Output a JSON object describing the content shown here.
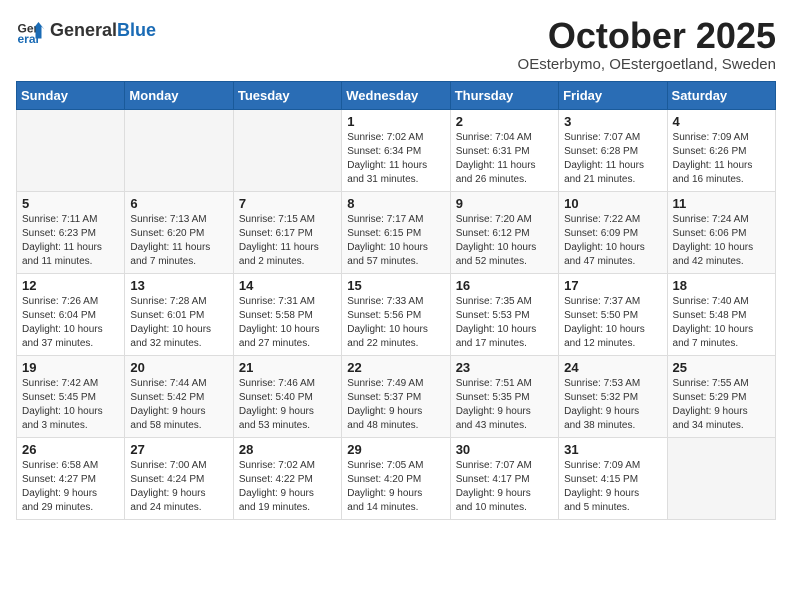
{
  "header": {
    "logo_general": "General",
    "logo_blue": "Blue",
    "month": "October 2025",
    "location": "OEsterbymo, OEstergoetland, Sweden"
  },
  "weekdays": [
    "Sunday",
    "Monday",
    "Tuesday",
    "Wednesday",
    "Thursday",
    "Friday",
    "Saturday"
  ],
  "weeks": [
    [
      {
        "day": "",
        "info": ""
      },
      {
        "day": "",
        "info": ""
      },
      {
        "day": "",
        "info": ""
      },
      {
        "day": "1",
        "info": "Sunrise: 7:02 AM\nSunset: 6:34 PM\nDaylight: 11 hours\nand 31 minutes."
      },
      {
        "day": "2",
        "info": "Sunrise: 7:04 AM\nSunset: 6:31 PM\nDaylight: 11 hours\nand 26 minutes."
      },
      {
        "day": "3",
        "info": "Sunrise: 7:07 AM\nSunset: 6:28 PM\nDaylight: 11 hours\nand 21 minutes."
      },
      {
        "day": "4",
        "info": "Sunrise: 7:09 AM\nSunset: 6:26 PM\nDaylight: 11 hours\nand 16 minutes."
      }
    ],
    [
      {
        "day": "5",
        "info": "Sunrise: 7:11 AM\nSunset: 6:23 PM\nDaylight: 11 hours\nand 11 minutes."
      },
      {
        "day": "6",
        "info": "Sunrise: 7:13 AM\nSunset: 6:20 PM\nDaylight: 11 hours\nand 7 minutes."
      },
      {
        "day": "7",
        "info": "Sunrise: 7:15 AM\nSunset: 6:17 PM\nDaylight: 11 hours\nand 2 minutes."
      },
      {
        "day": "8",
        "info": "Sunrise: 7:17 AM\nSunset: 6:15 PM\nDaylight: 10 hours\nand 57 minutes."
      },
      {
        "day": "9",
        "info": "Sunrise: 7:20 AM\nSunset: 6:12 PM\nDaylight: 10 hours\nand 52 minutes."
      },
      {
        "day": "10",
        "info": "Sunrise: 7:22 AM\nSunset: 6:09 PM\nDaylight: 10 hours\nand 47 minutes."
      },
      {
        "day": "11",
        "info": "Sunrise: 7:24 AM\nSunset: 6:06 PM\nDaylight: 10 hours\nand 42 minutes."
      }
    ],
    [
      {
        "day": "12",
        "info": "Sunrise: 7:26 AM\nSunset: 6:04 PM\nDaylight: 10 hours\nand 37 minutes."
      },
      {
        "day": "13",
        "info": "Sunrise: 7:28 AM\nSunset: 6:01 PM\nDaylight: 10 hours\nand 32 minutes."
      },
      {
        "day": "14",
        "info": "Sunrise: 7:31 AM\nSunset: 5:58 PM\nDaylight: 10 hours\nand 27 minutes."
      },
      {
        "day": "15",
        "info": "Sunrise: 7:33 AM\nSunset: 5:56 PM\nDaylight: 10 hours\nand 22 minutes."
      },
      {
        "day": "16",
        "info": "Sunrise: 7:35 AM\nSunset: 5:53 PM\nDaylight: 10 hours\nand 17 minutes."
      },
      {
        "day": "17",
        "info": "Sunrise: 7:37 AM\nSunset: 5:50 PM\nDaylight: 10 hours\nand 12 minutes."
      },
      {
        "day": "18",
        "info": "Sunrise: 7:40 AM\nSunset: 5:48 PM\nDaylight: 10 hours\nand 7 minutes."
      }
    ],
    [
      {
        "day": "19",
        "info": "Sunrise: 7:42 AM\nSunset: 5:45 PM\nDaylight: 10 hours\nand 3 minutes."
      },
      {
        "day": "20",
        "info": "Sunrise: 7:44 AM\nSunset: 5:42 PM\nDaylight: 9 hours\nand 58 minutes."
      },
      {
        "day": "21",
        "info": "Sunrise: 7:46 AM\nSunset: 5:40 PM\nDaylight: 9 hours\nand 53 minutes."
      },
      {
        "day": "22",
        "info": "Sunrise: 7:49 AM\nSunset: 5:37 PM\nDaylight: 9 hours\nand 48 minutes."
      },
      {
        "day": "23",
        "info": "Sunrise: 7:51 AM\nSunset: 5:35 PM\nDaylight: 9 hours\nand 43 minutes."
      },
      {
        "day": "24",
        "info": "Sunrise: 7:53 AM\nSunset: 5:32 PM\nDaylight: 9 hours\nand 38 minutes."
      },
      {
        "day": "25",
        "info": "Sunrise: 7:55 AM\nSunset: 5:29 PM\nDaylight: 9 hours\nand 34 minutes."
      }
    ],
    [
      {
        "day": "26",
        "info": "Sunrise: 6:58 AM\nSunset: 4:27 PM\nDaylight: 9 hours\nand 29 minutes."
      },
      {
        "day": "27",
        "info": "Sunrise: 7:00 AM\nSunset: 4:24 PM\nDaylight: 9 hours\nand 24 minutes."
      },
      {
        "day": "28",
        "info": "Sunrise: 7:02 AM\nSunset: 4:22 PM\nDaylight: 9 hours\nand 19 minutes."
      },
      {
        "day": "29",
        "info": "Sunrise: 7:05 AM\nSunset: 4:20 PM\nDaylight: 9 hours\nand 14 minutes."
      },
      {
        "day": "30",
        "info": "Sunrise: 7:07 AM\nSunset: 4:17 PM\nDaylight: 9 hours\nand 10 minutes."
      },
      {
        "day": "31",
        "info": "Sunrise: 7:09 AM\nSunset: 4:15 PM\nDaylight: 9 hours\nand 5 minutes."
      },
      {
        "day": "",
        "info": ""
      }
    ]
  ]
}
